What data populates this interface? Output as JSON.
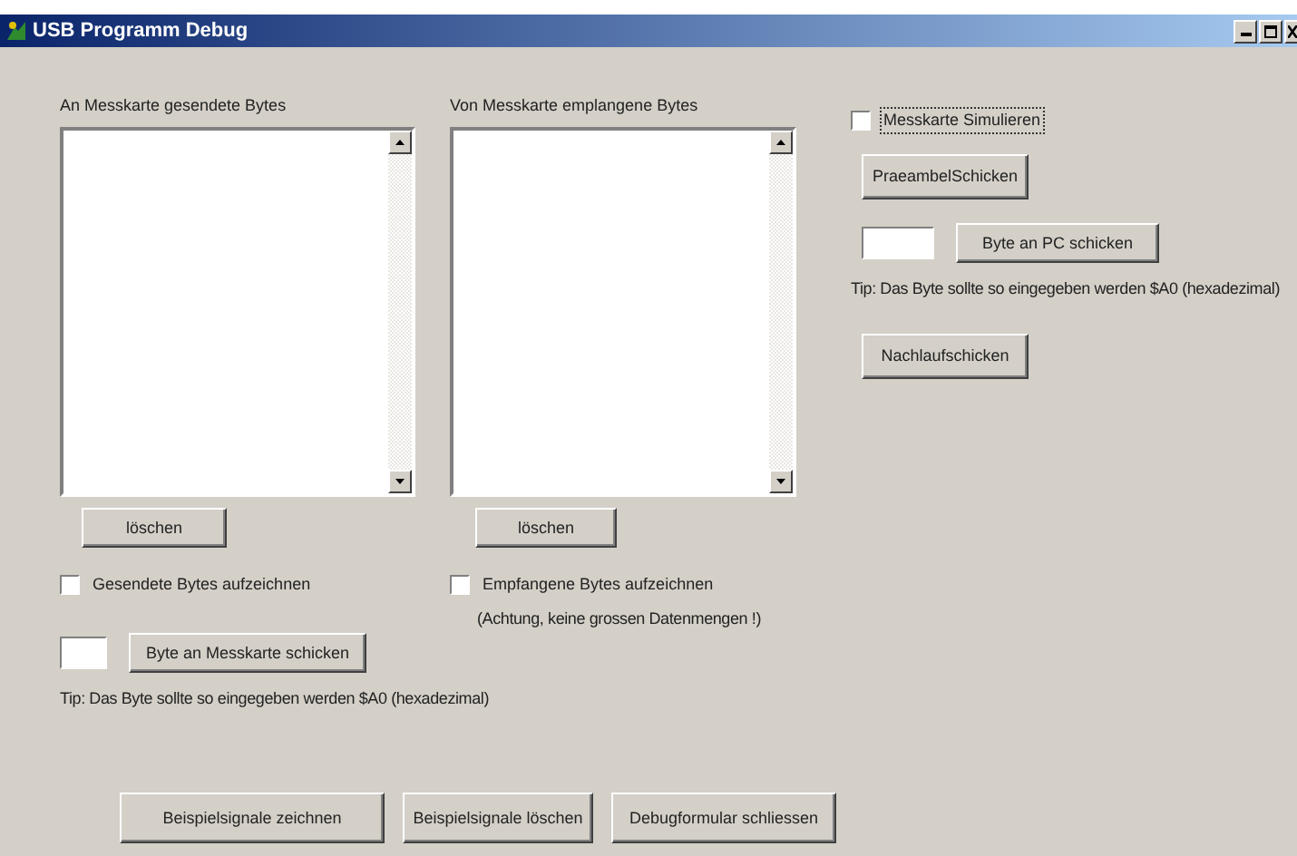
{
  "window": {
    "title": "USB Programm Debug"
  },
  "sent": {
    "label": "An Messkarte gesendete Bytes",
    "clear_button": "löschen",
    "record": {
      "label": "Gesendete Bytes aufzeichnen",
      "checked": false
    },
    "send_button": "Byte an Messkarte schicken",
    "tip": "Tip: Das Byte sollte so eingegeben werden $A0 (hexadezimal)"
  },
  "received": {
    "label": "Von Messkarte emplangene Bytes",
    "clear_button": "löschen",
    "record": {
      "label": "Empfangene Bytes aufzeichnen",
      "checked": false
    },
    "note": "(Achtung, keine grossen Datenmengen !)"
  },
  "simulation": {
    "simulate": {
      "label": "Messkarte Simulieren",
      "checked": false,
      "focused": true
    },
    "preamble_button": "PraeambelSchicken",
    "send_button": "Byte an PC schicken",
    "tip": "Tip: Das Byte sollte so eingegeben werden $A0 (hexadezimal)",
    "trailer_button": "Nachlaufschicken"
  },
  "buttons": [
    "Beispielsignale zeichnen",
    "Beispielsignale löschen",
    "Debugformular schliessen"
  ]
}
